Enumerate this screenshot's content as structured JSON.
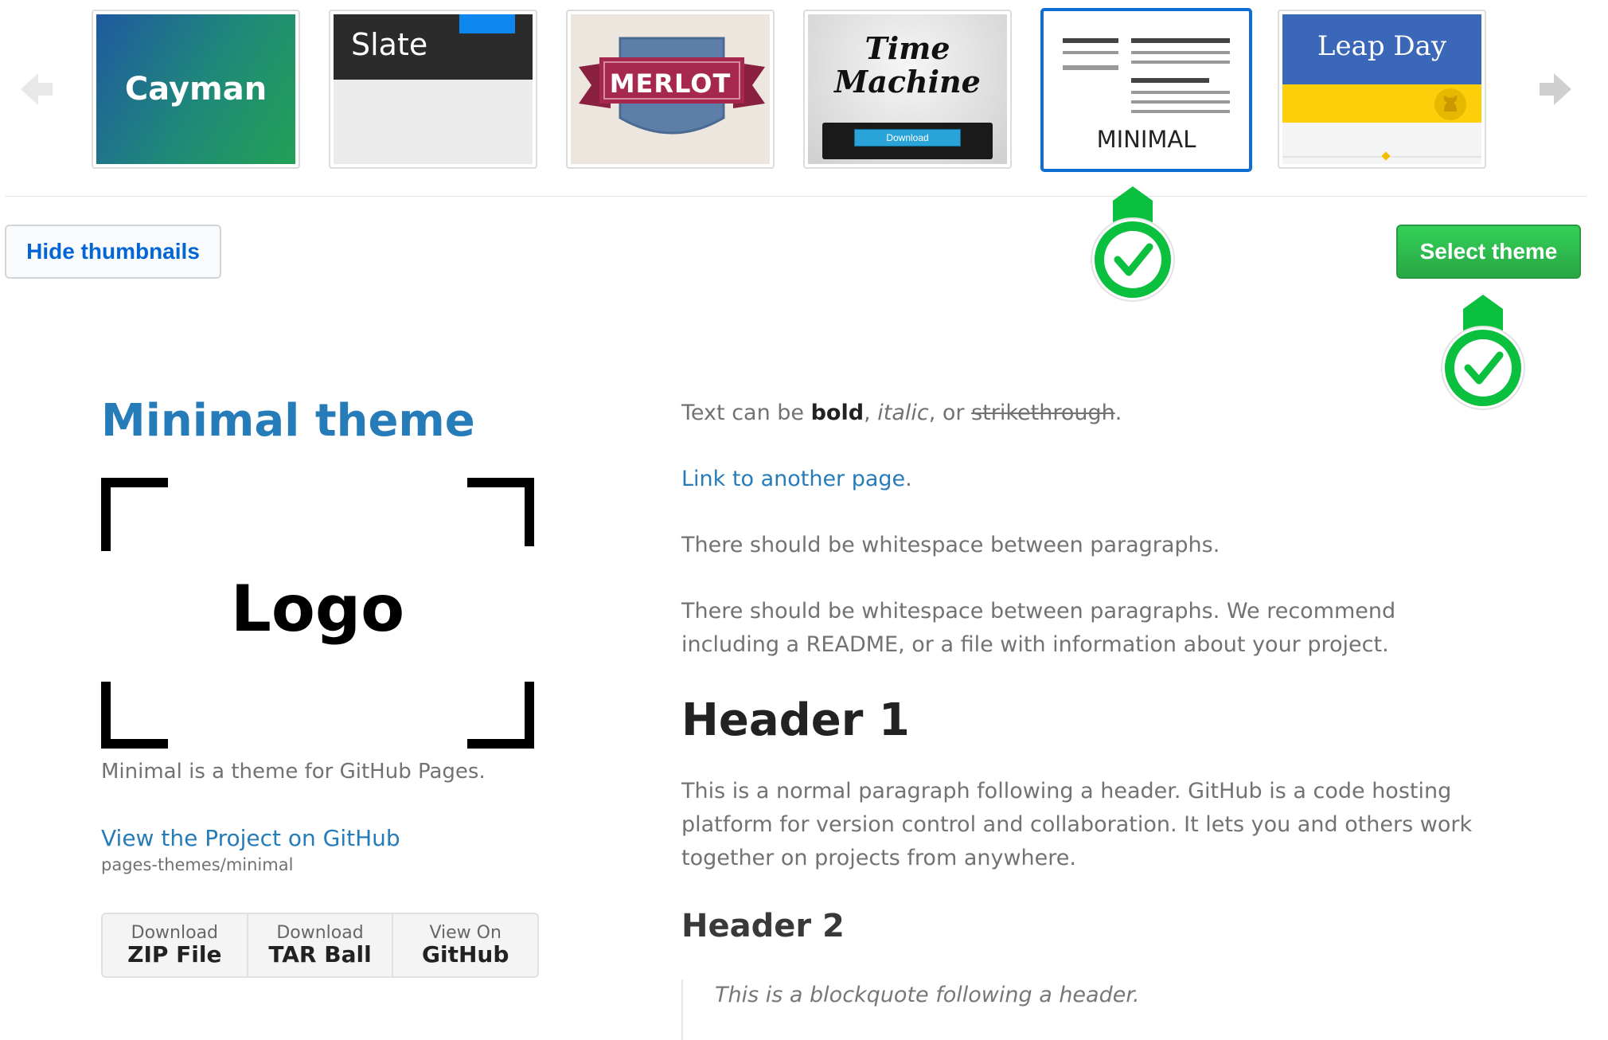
{
  "themes": [
    {
      "name": "Cayman",
      "selected": false
    },
    {
      "name": "Slate",
      "selected": false
    },
    {
      "name": "MERLOT",
      "selected": false
    },
    {
      "name": "Time Machine",
      "line1": "Time",
      "line2": "Machine",
      "button": "Download",
      "selected": false
    },
    {
      "name": "MINIMAL",
      "selected": true
    },
    {
      "name": "Leap Day",
      "selected": false
    }
  ],
  "toolbar": {
    "hide_thumbnails_label": "Hide thumbnails",
    "select_theme_label": "Select theme"
  },
  "colors": {
    "accent_blue": "#0f6ed3",
    "link": "#267CB9",
    "select_green": "#28a745",
    "marker_green": "#0bbf3f"
  },
  "preview": {
    "title": "Minimal theme",
    "logo_text": "Logo",
    "description": "Minimal is a theme for GitHub Pages.",
    "project_link": "View the Project on GitHub",
    "project_repo": "pages-themes/minimal",
    "downloads": [
      {
        "small": "Download",
        "big": "ZIP File"
      },
      {
        "small": "Download",
        "big": "TAR Ball"
      },
      {
        "small": "View On",
        "big": "GitHub"
      }
    ],
    "content": {
      "text_prefix": "Text can be ",
      "bold": "bold",
      "sep1": ", ",
      "italic": "italic",
      "sep2": ", or ",
      "strike": "strikethrough",
      "end": ".",
      "link": "Link to another page",
      "link_end": ".",
      "para1": "There should be whitespace between paragraphs.",
      "para2_line1": "There should be whitespace between paragraphs. We recommend",
      "para2_line2": "including a README, or a file with information about your project.",
      "header1": "Header 1",
      "para3_line1": "This is a normal paragraph following a header. GitHub is a code hosting",
      "para3_line2": "platform for version control and collaboration. It lets you and others work",
      "para3_line3": "together on projects from anywhere.",
      "header2": "Header 2",
      "blockquote": "This is a blockquote following a header."
    }
  }
}
